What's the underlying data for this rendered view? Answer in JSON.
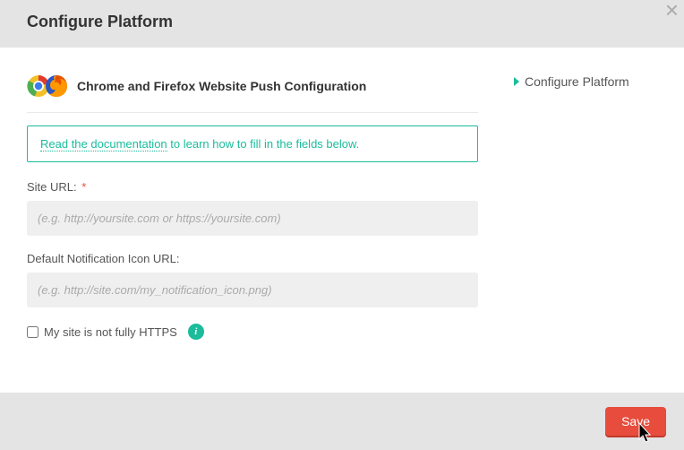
{
  "header": {
    "title": "Configure Platform"
  },
  "section": {
    "title": "Chrome and Firefox Website Push Configuration"
  },
  "info_box": {
    "link_text": "Read the documentation",
    "rest_text": " to learn how to fill in the fields below."
  },
  "fields": {
    "site_url": {
      "label": "Site URL:",
      "required_mark": "*",
      "placeholder": "(e.g. http://yoursite.com or https://yoursite.com)",
      "value": ""
    },
    "icon_url": {
      "label": "Default Notification Icon URL:",
      "placeholder": "(e.g. http://site.com/my_notification_icon.png)",
      "value": ""
    },
    "not_https": {
      "label": "My site is not fully HTTPS",
      "help_icon_text": "i"
    }
  },
  "sidebar": {
    "item_label": "Configure Platform"
  },
  "footer": {
    "save_label": "Save"
  }
}
